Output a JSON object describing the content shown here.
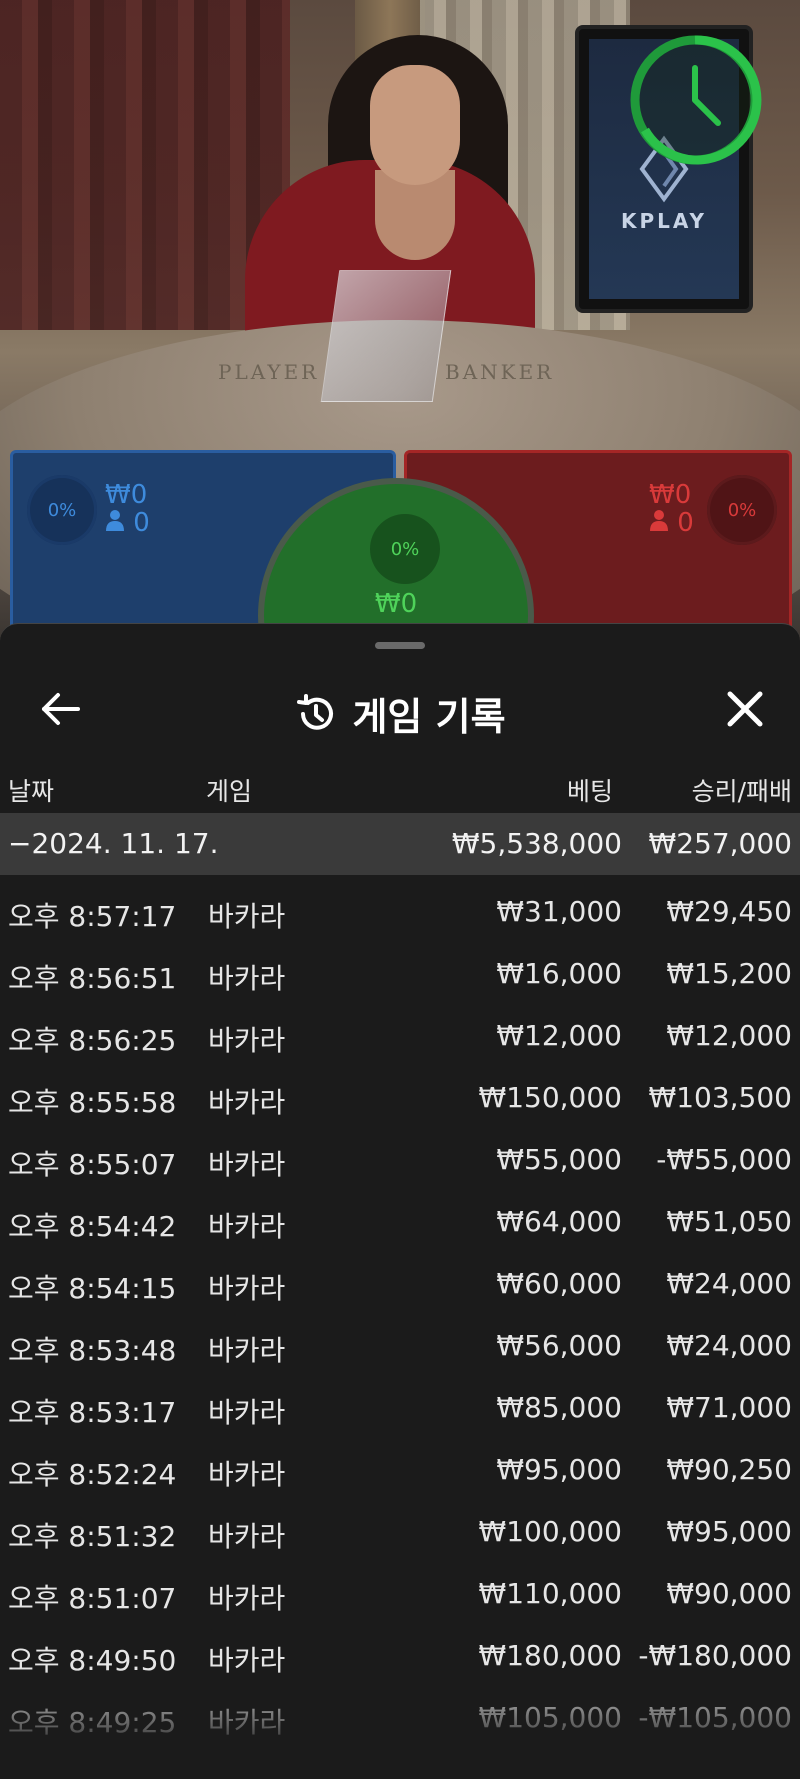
{
  "video": {
    "table_player": "PLAYER",
    "table_banker": "BANKER",
    "monitor_logo": "KPLAY"
  },
  "bets": {
    "player": {
      "pct": "0%",
      "amount": "₩0",
      "count": "0",
      "color": "#2a5da0"
    },
    "banker": {
      "pct": "0%",
      "amount": "₩0",
      "count": "0",
      "color": "#a42626"
    },
    "tie": {
      "pct": "0%",
      "amount": "₩0",
      "color": "#226f2a"
    }
  },
  "sheet": {
    "title": "게임 기록",
    "columns": {
      "date": "날짜",
      "game": "게임",
      "bet": "베팅",
      "result": "승리/패배"
    },
    "summary": {
      "date": "−2024. 11. 17.",
      "bet": "₩5,538,000",
      "result": "₩257,000"
    },
    "rows": [
      {
        "time": "오후 8:57:17",
        "game": "바카라",
        "bet": "₩31,000",
        "result": "₩29,450"
      },
      {
        "time": "오후 8:56:51",
        "game": "바카라",
        "bet": "₩16,000",
        "result": "₩15,200"
      },
      {
        "time": "오후 8:56:25",
        "game": "바카라",
        "bet": "₩12,000",
        "result": "₩12,000"
      },
      {
        "time": "오후 8:55:58",
        "game": "바카라",
        "bet": "₩150,000",
        "result": "₩103,500"
      },
      {
        "time": "오후 8:55:07",
        "game": "바카라",
        "bet": "₩55,000",
        "result": "-₩55,000"
      },
      {
        "time": "오후 8:54:42",
        "game": "바카라",
        "bet": "₩64,000",
        "result": "₩51,050"
      },
      {
        "time": "오후 8:54:15",
        "game": "바카라",
        "bet": "₩60,000",
        "result": "₩24,000"
      },
      {
        "time": "오후 8:53:48",
        "game": "바카라",
        "bet": "₩56,000",
        "result": "₩24,000"
      },
      {
        "time": "오후 8:53:17",
        "game": "바카라",
        "bet": "₩85,000",
        "result": "₩71,000"
      },
      {
        "time": "오후 8:52:24",
        "game": "바카라",
        "bet": "₩95,000",
        "result": "₩90,250"
      },
      {
        "time": "오후 8:51:32",
        "game": "바카라",
        "bet": "₩100,000",
        "result": "₩95,000"
      },
      {
        "time": "오후 8:51:07",
        "game": "바카라",
        "bet": "₩110,000",
        "result": "₩90,000"
      },
      {
        "time": "오후 8:49:50",
        "game": "바카라",
        "bet": "₩180,000",
        "result": "-₩180,000"
      },
      {
        "time": "오후 8:49:25",
        "game": "바카라",
        "bet": "₩105,000",
        "result": "-₩105,000"
      }
    ]
  }
}
